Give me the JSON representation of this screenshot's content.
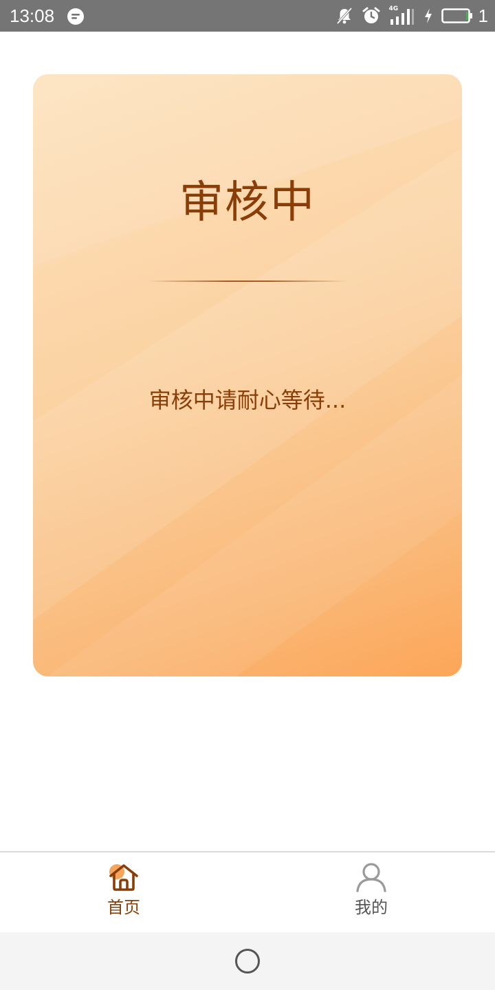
{
  "status_bar": {
    "time": "13:08",
    "battery_text": "1",
    "network_label": "4G",
    "icons": [
      "message-icon",
      "bell-muted-icon",
      "alarm-icon",
      "signal-icon",
      "charging-icon",
      "battery-icon"
    ]
  },
  "card": {
    "title": "审核中",
    "message": "审核中请耐心等待..."
  },
  "nav": {
    "items": [
      {
        "label": "首页",
        "icon": "home-icon",
        "active": true
      },
      {
        "label": "我的",
        "icon": "user-icon",
        "active": false
      }
    ]
  },
  "colors": {
    "primary_text": "#8a3d06",
    "inactive_text": "#555555",
    "card_gradient_start": "#fde2bd",
    "card_gradient_end": "#fca658",
    "status_bar_bg": "#757575"
  }
}
